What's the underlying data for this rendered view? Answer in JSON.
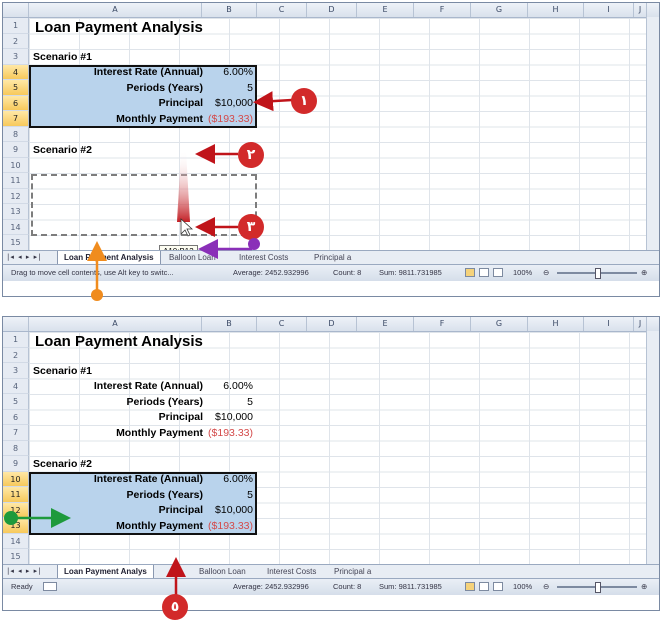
{
  "columns": [
    "A",
    "B",
    "C",
    "D",
    "E",
    "F",
    "G",
    "H",
    "I",
    "J"
  ],
  "top": {
    "rows": [
      "1",
      "2",
      "3",
      "4",
      "5",
      "6",
      "7",
      "8",
      "9",
      "10",
      "11",
      "12",
      "13",
      "14",
      "15"
    ],
    "title": "Loan Payment Analysis",
    "scenario1_label": "Scenario #1",
    "scenario2_label": "Scenario #2",
    "labels": [
      "Interest Rate (Annual)",
      "Periods (Years)",
      "Principal",
      "Monthly Payment"
    ],
    "values": [
      "6.00%",
      "5",
      "$10,000",
      "($193.33)"
    ],
    "tooltip": "A10:B13",
    "callout1": "١",
    "callout2": "٢",
    "callout3": "٣",
    "tabs": [
      "Loan Payment Analysis",
      "Balloon Loan",
      "Interest Costs",
      "Principal a"
    ],
    "status_text": "Drag to move cell contents, use Alt key to switc...",
    "average": "Average: 2452.932996",
    "count": "Count: 8",
    "sum": "Sum: 9811.731985",
    "zoom": "100%"
  },
  "bottom": {
    "rows": [
      "1",
      "2",
      "3",
      "4",
      "5",
      "6",
      "7",
      "8",
      "9",
      "10",
      "11",
      "12",
      "13",
      "14",
      "15"
    ],
    "title": "Loan Payment Analysis",
    "scenario1_label": "Scenario #1",
    "scenario2_label": "Scenario #2",
    "labels": [
      "Interest Rate (Annual)",
      "Periods (Years)",
      "Principal",
      "Monthly Payment"
    ],
    "values": [
      "6.00%",
      "5",
      "$10,000",
      "($193.33)"
    ],
    "labels2": [
      "Interest Rate (Annual)",
      "Periods (Years)",
      "Principal",
      "Monthly Payment"
    ],
    "values2": [
      "6.00%",
      "5",
      "$10,000",
      "($193.33)"
    ],
    "callout5": "٥",
    "tabs": [
      "Loan Payment Analys",
      "Balloon Loan",
      "Interest Costs",
      "Principal a"
    ],
    "status_text": "Ready",
    "average": "Average: 2452.932996",
    "count": "Count: 8",
    "sum": "Sum: 9811.731985",
    "zoom": "100%"
  },
  "colors": {
    "selection_fill": "#b9d3ec",
    "callout_red": "#d22a2a",
    "negative_red": "#d44a4a",
    "purple_marker": "#8a2fb8",
    "orange_marker": "#f08c1e",
    "green_marker": "#1e9a3c"
  }
}
